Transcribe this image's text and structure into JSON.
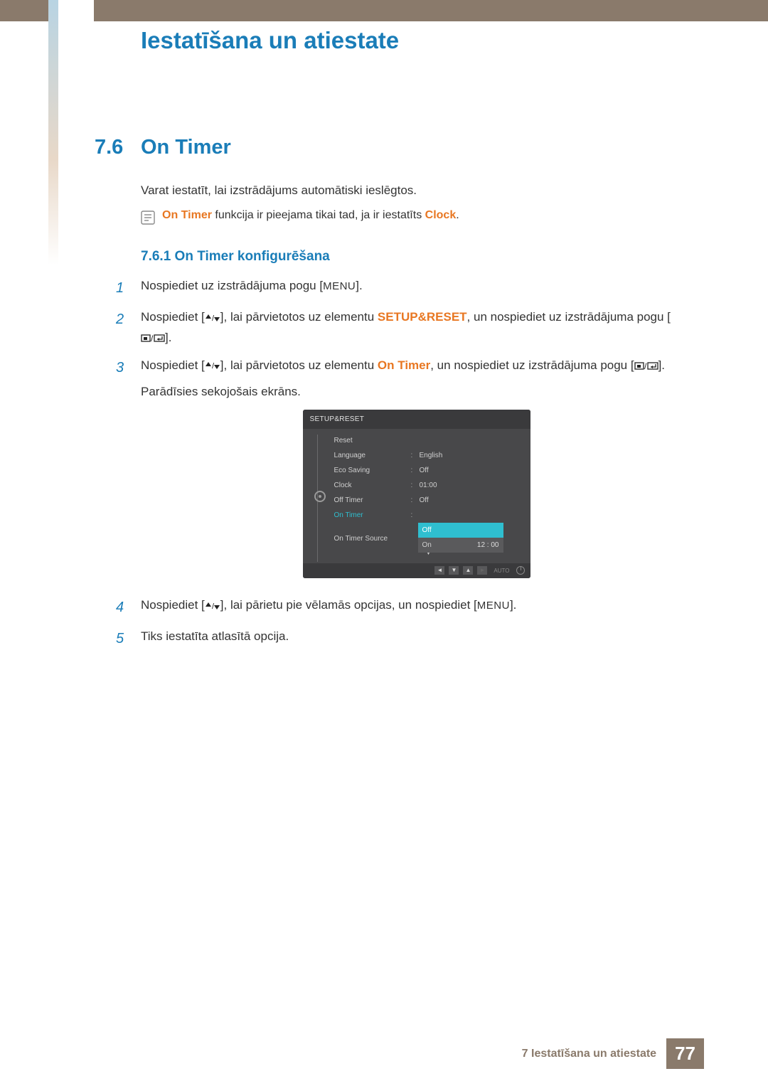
{
  "chapter_title": "Iestatīšana un atiestate",
  "section": {
    "num": "7.6",
    "title": "On Timer"
  },
  "intro": "Varat iestatīt, lai izstrādājums automātiski ieslēgtos.",
  "note": {
    "kw1": "On Timer",
    "mid": " funkcija ir pieejama tikai tad, ja ir iestatīts ",
    "kw2": "Clock",
    "tail": "."
  },
  "subsection": "7.6.1  On Timer konfigurēšana",
  "steps": {
    "s1": {
      "a": "Nospiediet uz izstrādājuma pogu [",
      "menu": "MENU",
      "b": "]."
    },
    "s2": {
      "a": "Nospiediet [",
      "b": "], lai pārvietotos uz elementu ",
      "kw": "SETUP&RESET",
      "c": ", un nospiediet uz izstrādājuma pogu [",
      "d": "]."
    },
    "s3": {
      "a": "Nospiediet [",
      "b": "], lai pārvietotos uz elementu ",
      "kw": "On Timer",
      "c": ", un nospiediet uz izstrādājuma pogu [",
      "d": "].",
      "line2": "Parādīsies sekojošais ekrāns."
    },
    "s4": {
      "a": "Nospiediet [",
      "b": "], lai pārietu pie vēlamās opcijas, un nospiediet [",
      "menu": "MENU",
      "c": "]."
    },
    "s5": "Tiks iestatīta atlasītā opcija."
  },
  "osd": {
    "title": "SETUP&RESET",
    "rows": [
      {
        "label": "Reset",
        "val": ""
      },
      {
        "label": "Language",
        "val": "English"
      },
      {
        "label": "Eco Saving",
        "val": "Off"
      },
      {
        "label": "Clock",
        "val": "01:00"
      },
      {
        "label": "Off Timer",
        "val": "Off"
      },
      {
        "label": "On Timer",
        "val": "Off",
        "active": true
      },
      {
        "label": "On Timer Source",
        "val": ""
      }
    ],
    "popup": {
      "off": "Off",
      "on": "On",
      "time": "12 : 00"
    },
    "footer_auto": "AUTO"
  },
  "footer": {
    "chapter": "7 Iestatīšana un atiestate",
    "page": "77"
  }
}
